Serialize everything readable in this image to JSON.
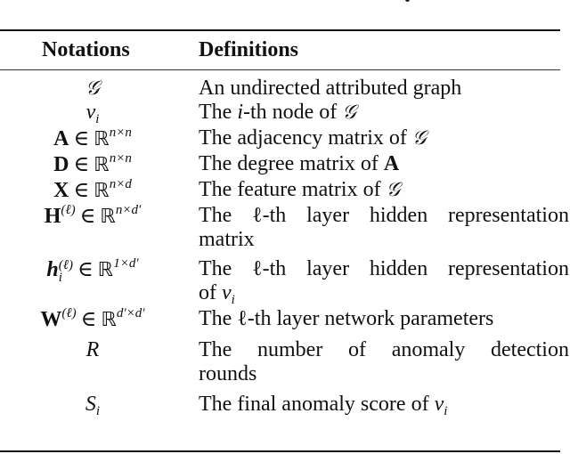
{
  "table": {
    "headers": {
      "notation": "Notations",
      "definition": "Definitions"
    },
    "rows": [
      {
        "notation": {
          "symbol": "𝒢"
        },
        "definition": {
          "lines": [
            "An undirected attributed graph"
          ]
        }
      },
      {
        "notation": {
          "symbol": "v",
          "sub": "i"
        },
        "definition": {
          "before": "The ",
          "var": "i",
          "after": "-th node of ",
          "tail": "𝒢"
        }
      },
      {
        "notation": {
          "symbol": "A",
          "rel": "∈",
          "space": "ℝ",
          "dims": "n×n"
        },
        "definition": {
          "text": "The adjacency matrix of ",
          "tail": "𝒢"
        }
      },
      {
        "notation": {
          "symbol": "D",
          "rel": "∈",
          "space": "ℝ",
          "dims": "n×n"
        },
        "definition": {
          "text": "The degree matrix of ",
          "tail": "A"
        }
      },
      {
        "notation": {
          "symbol": "X",
          "rel": "∈",
          "space": "ℝ",
          "dims": "n×d"
        },
        "definition": {
          "text": "The feature matrix of ",
          "tail": "𝒢"
        }
      },
      {
        "notation": {
          "symbol": "H",
          "sup": "(ℓ)",
          "rel": "∈",
          "space": "ℝ",
          "dims": "n×d′"
        },
        "definition": {
          "line1_words": [
            "The",
            "ℓ-th",
            "layer",
            "hidden",
            "representation"
          ],
          "line2": "matrix"
        }
      },
      {
        "notation": {
          "symbol": "h",
          "sup": "(ℓ)",
          "sub": "i",
          "rel": "∈",
          "space": "ℝ",
          "dims": "1×d′"
        },
        "definition": {
          "line1_words": [
            "The",
            "ℓ-th",
            "layer",
            "hidden",
            "representation"
          ],
          "line2_prefix": "of ",
          "line2_var": "v",
          "line2_sub": "i"
        }
      },
      {
        "notation": {
          "symbol": "W",
          "sup": "(ℓ)",
          "rel": "∈",
          "space": "ℝ",
          "dims": "d′×d′"
        },
        "definition": {
          "text": "The ℓ-th layer network parameters"
        }
      },
      {
        "notation": {
          "symbol": "R"
        },
        "definition": {
          "line1_words": [
            "The",
            "number",
            "of",
            "anomaly",
            "detection"
          ],
          "line2": "rounds"
        }
      },
      {
        "notation": {
          "symbol": "S",
          "sub": "i"
        },
        "definition": {
          "text": "The final anomaly score of ",
          "tail_var": "v",
          "tail_sub": "i"
        }
      }
    ]
  }
}
